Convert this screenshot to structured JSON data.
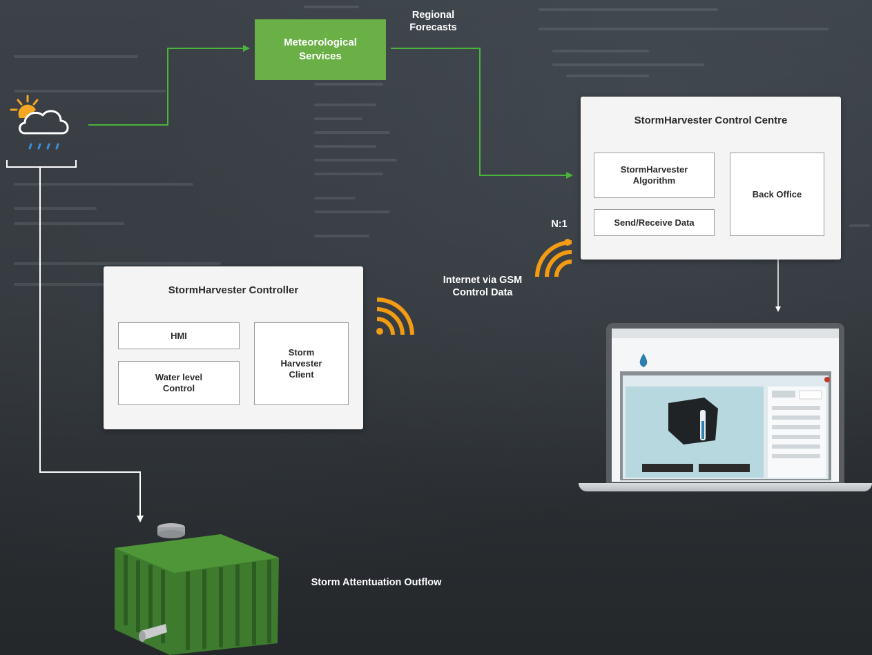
{
  "diagram": {
    "meteorological_services": "Meteorological Services",
    "regional_forecasts": "Regional Forecasts",
    "control_centre": {
      "title": "StormHarvester Control Centre",
      "algorithm": "StormHarvester Algorithm",
      "send_receive": "Send/Receive Data",
      "back_office": "Back Office"
    },
    "n1_label": "N:1",
    "internet_label": "Internet via GSM Control Data",
    "controller": {
      "title": "StormHarvester Controller",
      "hmi": "HMI",
      "water_level": "Water level Control",
      "client": "Storm Harvester Client"
    },
    "outflow_label": "Storm Attentuation Outflow"
  },
  "colors": {
    "accent_green": "#6ab046",
    "wifi_orange": "#f39c12",
    "connector_white": "#ffffff"
  },
  "icons": [
    "weather-cloud-icon",
    "wifi-signal-icon",
    "tank-icon",
    "laptop-icon"
  ]
}
